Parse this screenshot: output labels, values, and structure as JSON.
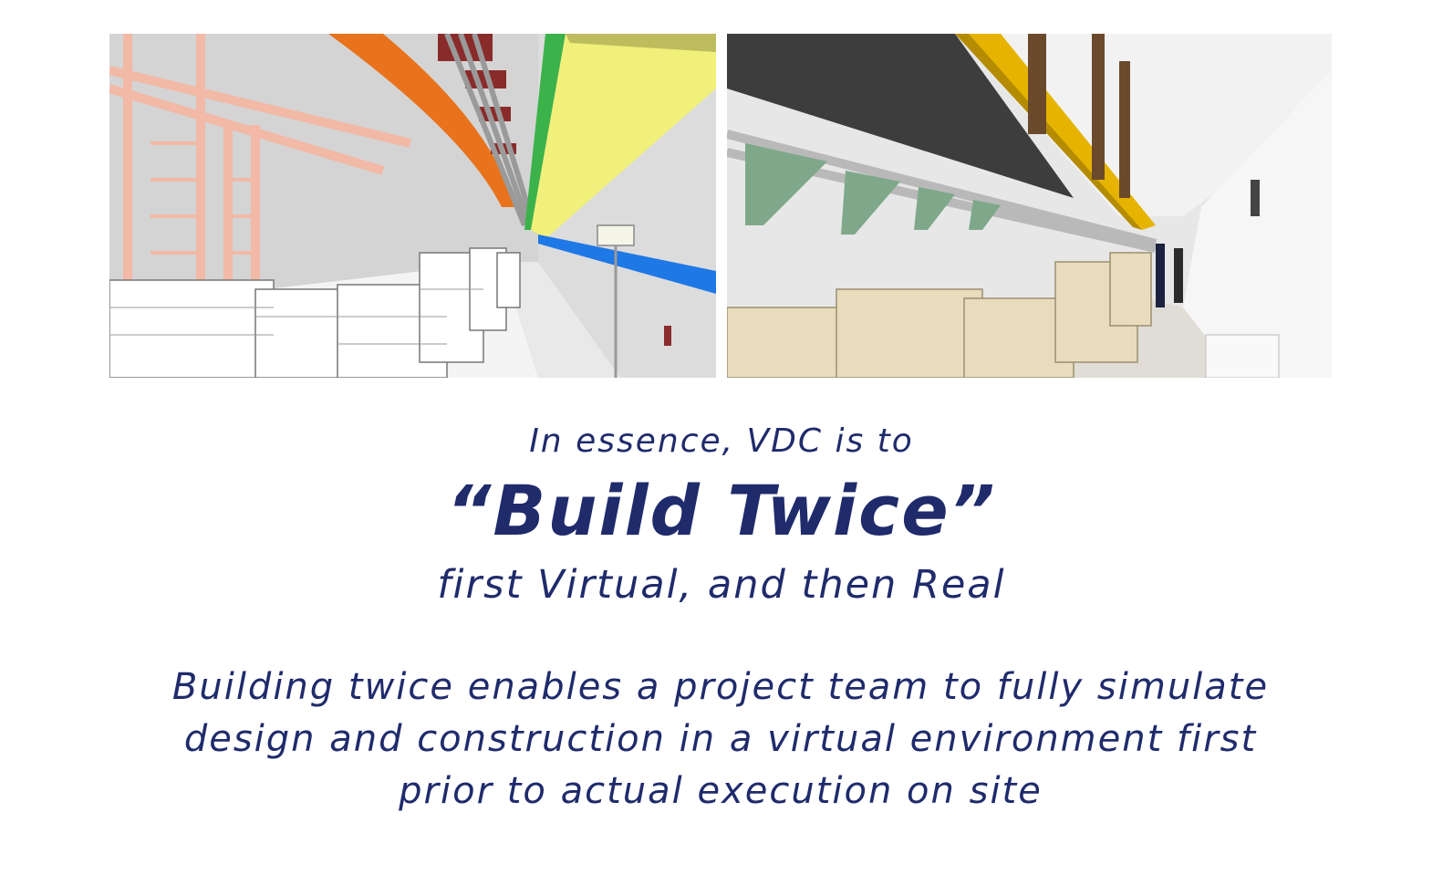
{
  "images": {
    "left": "virtual model rendering of tunnel utilities",
    "right": "photograph of constructed tunnel utilities"
  },
  "text": {
    "intro": "In essence, VDC is to",
    "headline": "“Build Twice”",
    "tagline": "first Virtual, and then Real",
    "body_lines": [
      "Building twice enables a project team to fully simulate",
      "design and construction in a virtual environment first",
      "prior to actual execution on site"
    ]
  },
  "colors": {
    "text": "#1f2b6b",
    "orange_tray": "#e8731c",
    "yellow_duct": "#f0f07a",
    "green_duct": "#3cb24a",
    "blue_line": "#1e78e6",
    "pink_frame": "#f2b9a6",
    "real_yellow_tray": "#e6b400",
    "real_bracket": "#7fa88a"
  }
}
